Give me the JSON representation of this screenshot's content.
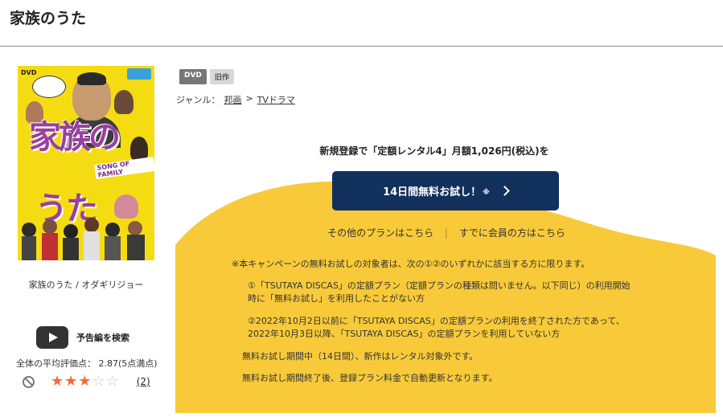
{
  "page": {
    "title": "家族のうた"
  },
  "product": {
    "cover_tag": "DVD",
    "caption": "家族のうた / オダギリジョー",
    "tags": [
      "DVD",
      "旧作"
    ],
    "genre": {
      "label": "ジャンル：",
      "items": [
        "邦画",
        "TVドラマ"
      ],
      "separator": ">"
    }
  },
  "trailer": {
    "label": "予告編を検索"
  },
  "rating": {
    "average_text": "全体の平均評価点： 2.87(5点満点)",
    "value": 2.87,
    "stars_filled": 3,
    "stars_total": 5,
    "count": "(2)"
  },
  "promo": {
    "headline": "新規登録で「定額レンタル4」月額1,026円(税込)を",
    "cta_label": "14日間無料お試し！",
    "cta_mark": "※",
    "link_other_plans": "その他のプランはこちら",
    "link_separator": "|",
    "link_members": "すでに会員の方はこちら",
    "notes": [
      "※本キャンペーンの無料お試しの対象者は、次の①②のいずれかに該当する方に限ります。",
      "①「TSUTAYA DISCAS」の定額プラン（定額プランの種類は問いません。以下同じ）の利用開始",
      "時に「無料お試し」を利用したことがない方",
      "②2022年10月2日以前に「TSUTAYA DISCAS」の定額プランの利用を終了された方であって、",
      "2022年10月3日以降、「TSUTAYA DISCAS」の定額プランを利用していない方",
      "無料お試し期間中（14日間）、新作はレンタル対象外です。",
      "無料お試し期間終了後、登録プラン料金で自動更新となります。"
    ]
  },
  "colors": {
    "navy": "#12305c",
    "yellow": "#f8ca3a",
    "star": "#f26c3a"
  }
}
